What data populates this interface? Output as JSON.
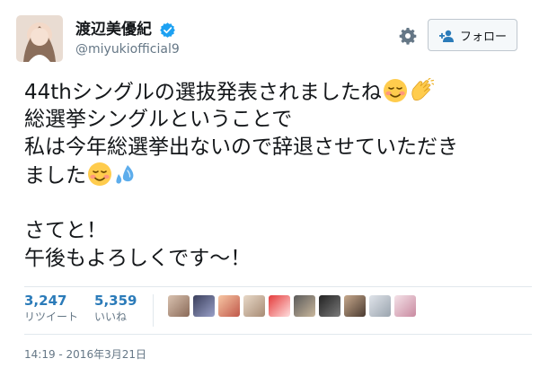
{
  "user": {
    "display_name": "渡辺美優紀",
    "handle": "@miyukiofficial9",
    "verified": true
  },
  "actions": {
    "follow_label": "フォロー"
  },
  "tweet": {
    "lines": [
      "44thシングルの選抜発表されましたね",
      "総選挙シングルということで",
      "私は今年総選挙出ないので辞退させていただき",
      "ました",
      "",
      "さてと！",
      "午後もよろしくです〜！"
    ],
    "emojis": {
      "line_1": [
        "relieved-smile-emoji",
        "clapping-hands-emoji"
      ],
      "line_4": [
        "relieved-smile-emoji",
        "sweat-droplets-emoji"
      ]
    }
  },
  "stats": {
    "retweets": {
      "count": "3,247",
      "label": "リツイート"
    },
    "likes": {
      "count": "5,359",
      "label": "いいね"
    }
  },
  "likers_count": 10,
  "timestamp": "14:19 - 2016年3月21日",
  "colors": {
    "link_blue": "#2b7bb9",
    "verified_blue": "#1da1f2",
    "muted": "#657786",
    "divider": "#e1e8ed"
  }
}
